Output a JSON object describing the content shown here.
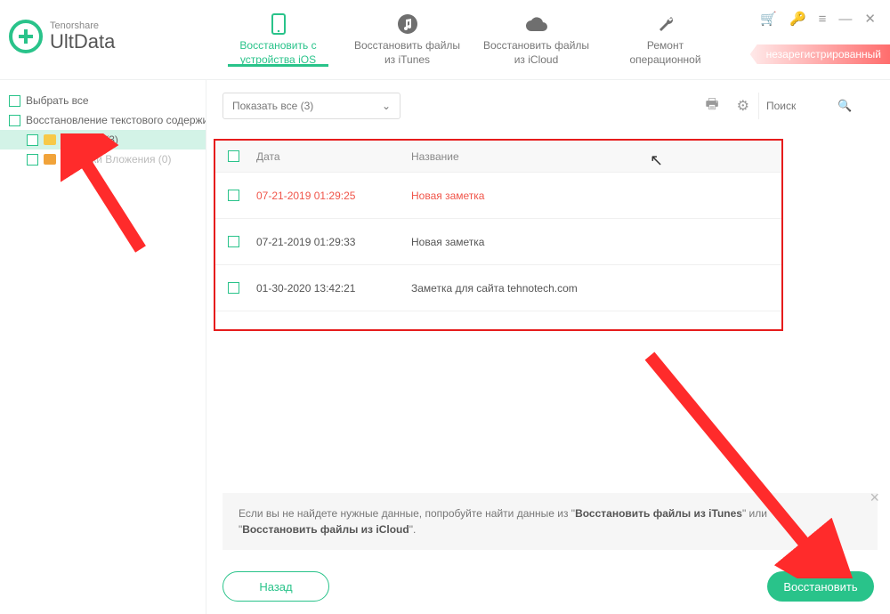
{
  "brand": {
    "small": "Tenorshare",
    "big": "UltData"
  },
  "tabs": {
    "ios": {
      "line1": "Восстановить с",
      "line2": "устройства iOS"
    },
    "itunes": {
      "line1": "Восстановить файлы",
      "line2": "из iTunes"
    },
    "icloud": {
      "line1": "Восстановить файлы",
      "line2": "из iCloud"
    },
    "repair": {
      "line1": "Ремонт",
      "line2": "операционной"
    }
  },
  "badge": "незарегистрированный",
  "sidebar": {
    "select_all": "Выбрать все",
    "text_content": "Восстановление текстового содержимо",
    "notes": "Заметки (3)",
    "notes_attach": "Заметки Вложения (0)"
  },
  "dropdown": {
    "label": "Показать все  (3)"
  },
  "search": {
    "placeholder": "Поиск"
  },
  "table": {
    "headers": {
      "date": "Дата",
      "title": "Название"
    },
    "rows": [
      {
        "date": "07-21-2019 01:29:25",
        "title": "Новая заметка",
        "deleted": true
      },
      {
        "date": "07-21-2019 01:29:33",
        "title": "Новая заметка",
        "deleted": false
      },
      {
        "date": "01-30-2020 13:42:21",
        "title": "Заметка для сайта tehnotech.com",
        "deleted": false
      }
    ]
  },
  "tip": {
    "pre": "Если вы не найдете нужные данные, попробуйте найти данные из \"",
    "b1": "Восстановить файлы из iTunes",
    "mid": "\" или \"",
    "b2": "Восстановить файлы из iCloud",
    "post": "\"."
  },
  "buttons": {
    "back": "Назад",
    "restore": "Восстановить"
  }
}
